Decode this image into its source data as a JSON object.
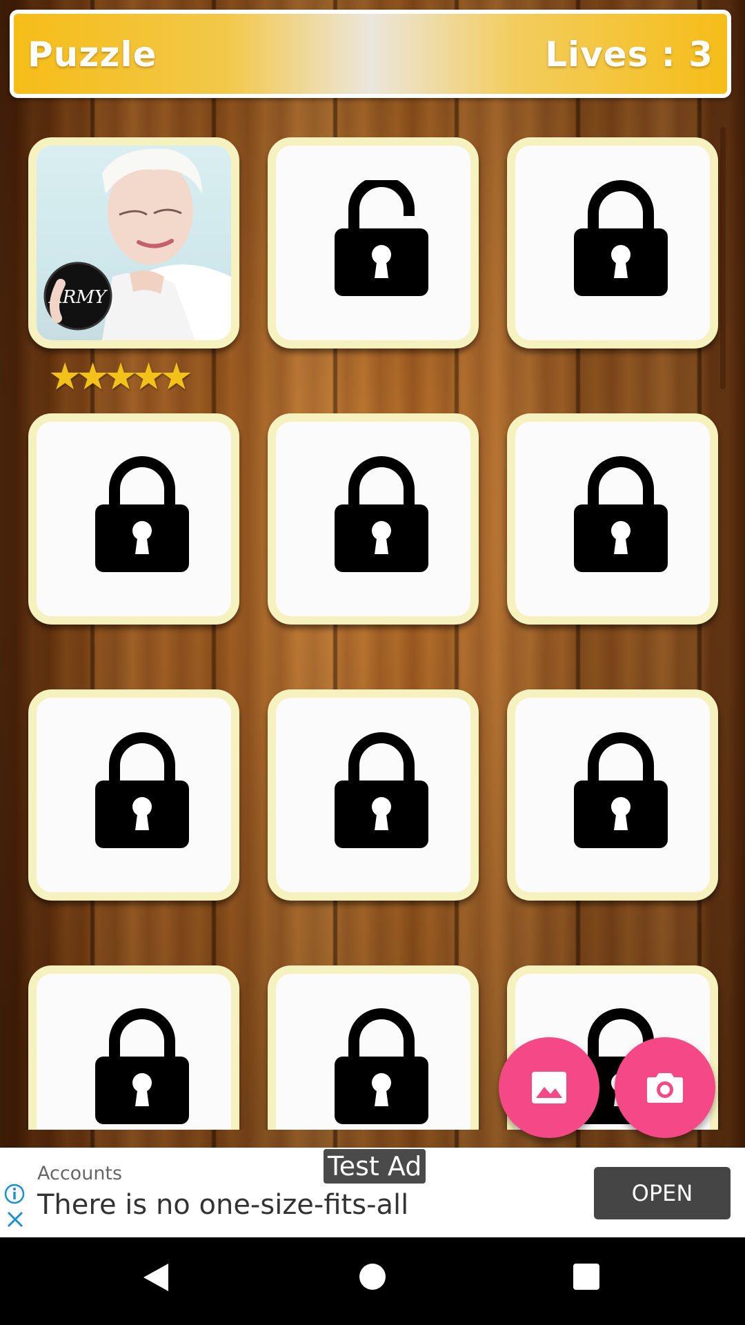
{
  "header": {
    "title": "Puzzle",
    "lives": "Lives : 3"
  },
  "levels": [
    {
      "state": "unlocked",
      "stars": 5,
      "label": "ARMY"
    },
    {
      "state": "open-lock"
    },
    {
      "state": "locked"
    },
    {
      "state": "locked"
    },
    {
      "state": "locked"
    },
    {
      "state": "locked"
    },
    {
      "state": "locked"
    },
    {
      "state": "locked"
    },
    {
      "state": "locked"
    },
    {
      "state": "locked"
    },
    {
      "state": "locked"
    },
    {
      "state": "locked"
    }
  ],
  "level1": {
    "badge_text": "ARMY",
    "stars_display": "★★★★★",
    "rating": 5,
    "max_rating": 5
  },
  "fabs": {
    "gallery_icon": "image-icon",
    "camera_icon": "camera-icon",
    "color": "#f54887"
  },
  "ad": {
    "badge": "Test Ad",
    "advertiser": "Accounts",
    "headline": "There is no one-size-fits-all",
    "cta": "OPEN"
  },
  "nav": {
    "back": "back-icon",
    "home": "home-icon",
    "recents": "recents-icon"
  },
  "colors": {
    "header_gold": "#f6bd18",
    "tile_border": "#f6f2bf",
    "star": "#f2c21b"
  }
}
